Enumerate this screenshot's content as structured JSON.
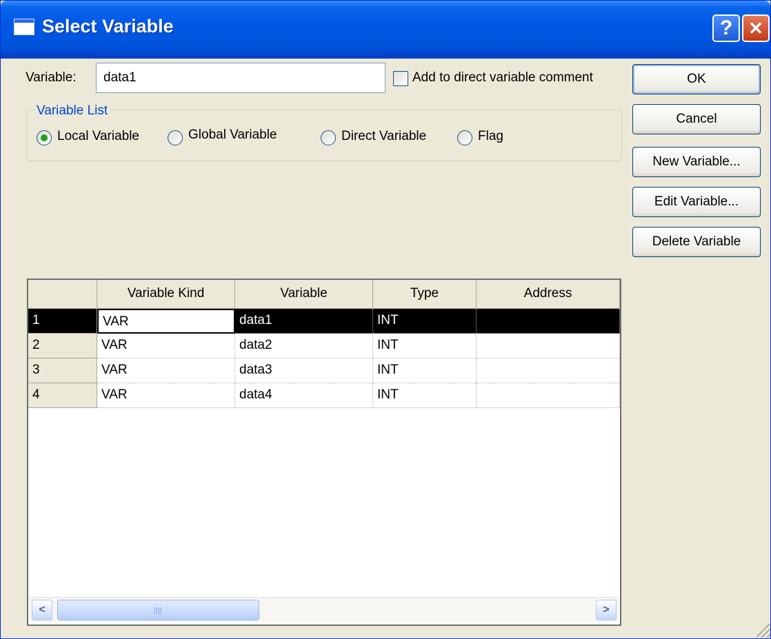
{
  "window": {
    "title": "Select Variable"
  },
  "titlebar": {
    "help_label": "?",
    "close_label": "✕"
  },
  "variable_field": {
    "label": "Variable:",
    "value": "data1"
  },
  "add_comment": {
    "label": "Add to direct variable comment",
    "checked": false
  },
  "variable_list": {
    "title": "Variable List",
    "options": [
      {
        "label": "Local Variable",
        "checked": true
      },
      {
        "label": "Global Variable",
        "checked": false
      },
      {
        "label": "Direct Variable",
        "checked": false
      },
      {
        "label": "Flag",
        "checked": false
      }
    ]
  },
  "buttons": {
    "ok": "OK",
    "cancel": "Cancel",
    "new_variable": "New Variable...",
    "edit_variable": "Edit Variable...",
    "delete_variable": "Delete Variable"
  },
  "grid": {
    "headers": [
      "",
      "Variable Kind",
      "Variable",
      "Type",
      "Address"
    ],
    "rows": [
      {
        "num": "1",
        "kind": "VAR",
        "variable": "data1",
        "type": "INT",
        "address": "",
        "selected": true
      },
      {
        "num": "2",
        "kind": "VAR",
        "variable": "data2",
        "type": "INT",
        "address": ""
      },
      {
        "num": "3",
        "kind": "VAR",
        "variable": "data3",
        "type": "INT",
        "address": ""
      },
      {
        "num": "4",
        "kind": "VAR",
        "variable": "data4",
        "type": "INT",
        "address": ""
      }
    ]
  },
  "scrollbar": {
    "left_arrow": "<",
    "right_arrow": ">"
  },
  "icons": {
    "title": "window-icon",
    "help": "help-icon",
    "close": "close-icon",
    "scroll_left": "chevron-left-icon",
    "scroll_right": "chevron-right-icon"
  },
  "colors": {
    "titlebar": "#0053d9",
    "dialog_bg": "#ece9d8",
    "group_title": "#0046d5",
    "selected_row": "#000000",
    "close_button": "#c33a18"
  }
}
